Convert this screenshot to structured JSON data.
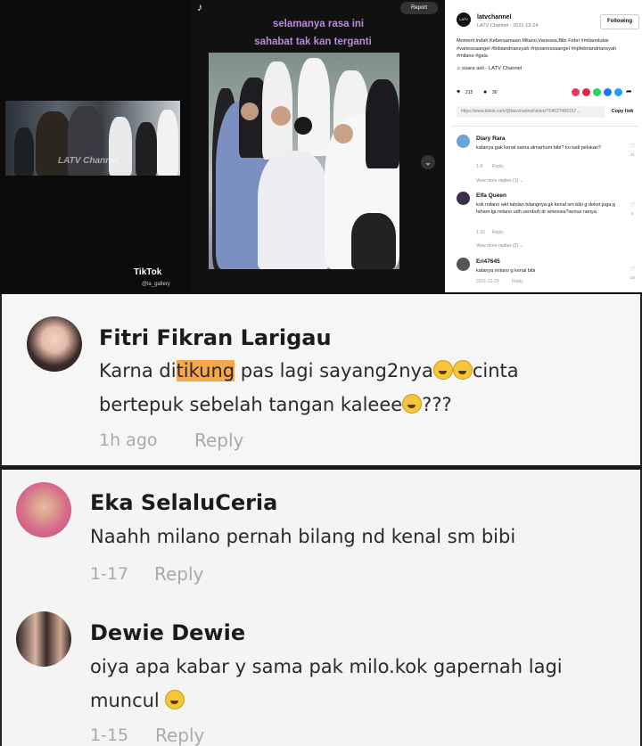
{
  "top": {
    "left_video": {
      "watermark": "LATV Channel",
      "tiktok_logo": "TikTok",
      "tiktok_user": "@la_gallery"
    },
    "mid_video": {
      "caption_line1": "selamanya rasa ini",
      "caption_line2": "sahabat tak kan terganti",
      "report_label": "Report"
    },
    "right_panel": {
      "channel_avatar_text": "LATV",
      "channel_name": "latvchannel",
      "channel_sub": "LATV Channel · 2021-12-24",
      "follow_label": "Following",
      "description": "Moment indah Kebersamaan Milano,Vanessa,Bibi Febri #milanolubis #vanessaangel #bibiandriansyah #ripvanessaangel #ripfebriandriansyah #milano #gala",
      "music": "♫ suara asli - LATV Channel",
      "likes": "215",
      "comments": "30",
      "url": "https://www.tiktok.com/@latvchannel/video/704527496157...",
      "copy_link_label": "Copy link",
      "comments_list": [
        {
          "name": "Diary Rara",
          "text": "katanya gak kenal sama almarhum bibi? ko tadi pelukan?",
          "date": "1-8",
          "reply": "Reply",
          "likes": "21",
          "more": "View more replies (1) ⌄"
        },
        {
          "name": "Elfa Queen",
          "text": "kok milano wkt tahilan bilangnya gk kenal sm bibi g deket juga:g faham lgi.milano udh sembuh dr amnesia?serius nanya",
          "date": "1-15",
          "reply": "Reply",
          "likes": "6",
          "more": "View more replies (2) ⌄"
        },
        {
          "name": "Eri47645",
          "text": "katanya milano g kenal bibi",
          "date": "2021-12-29",
          "reply": "Reply",
          "likes": "20"
        }
      ]
    }
  },
  "big_comments": [
    {
      "name": "Fitri Fikran Larigau",
      "text_before": "Karna di",
      "text_highlight": "tikung",
      "text_after": " pas lagi sayang2nya",
      "text_line2_start": "cinta",
      "text_line3": "bertepuk sebelah tangan kaleee",
      "text_line3_end": "???",
      "date": "1h ago",
      "reply": "Reply"
    },
    {
      "name": "Eka SelaluCeria",
      "text": "Naahh milano pernah bilang nd kenal sm bibi",
      "date": "1-17",
      "reply": "Reply"
    },
    {
      "name": "Dewie Dewie",
      "text_line1": "oiya apa kabar y sama pak milo.kok gapernah lagi",
      "text_line2": "muncul",
      "date": "1-15",
      "reply": "Reply"
    }
  ],
  "colors": {
    "caption": "#b98bd8",
    "highlight": "#f7a64a",
    "meta_gray": "#a9a9a9"
  }
}
